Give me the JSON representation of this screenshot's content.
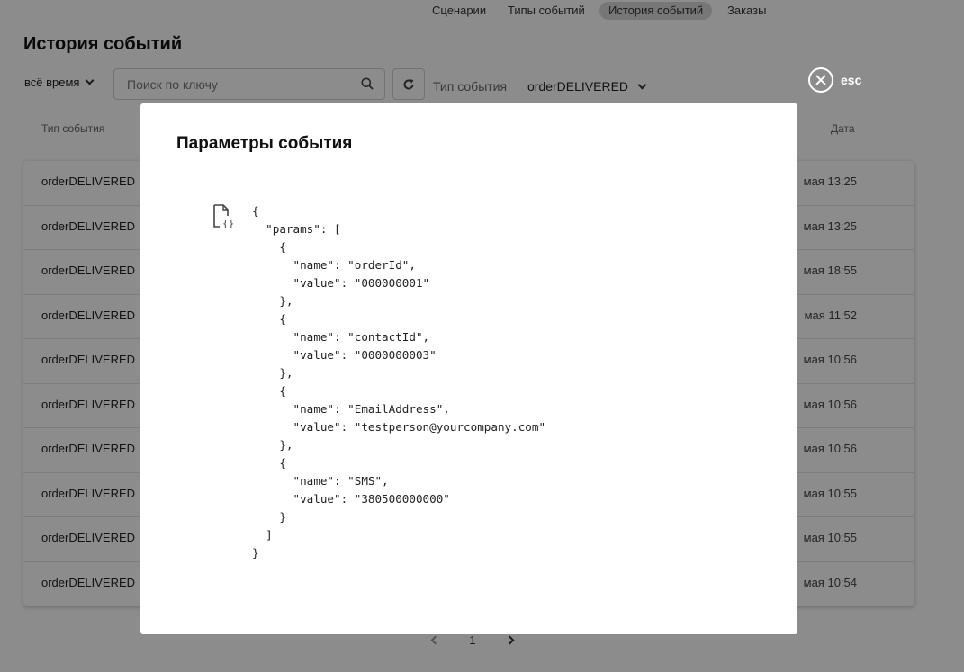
{
  "nav": {
    "items": [
      {
        "label": "Сценарии",
        "active": false
      },
      {
        "label": "Типы событий",
        "active": false
      },
      {
        "label": "История событий",
        "active": true
      },
      {
        "label": "Заказы",
        "active": false
      }
    ]
  },
  "page": {
    "title": "История событий"
  },
  "toolbar": {
    "period": "всё время",
    "search_placeholder": "Поиск по ключу",
    "type_label": "Тип события",
    "type_value": "orderDELIVERED"
  },
  "table": {
    "headers": {
      "type": "Тип события",
      "date": "Дата"
    },
    "rows": [
      {
        "type": "orderDELIVERED",
        "date": "мая 13:25"
      },
      {
        "type": "orderDELIVERED",
        "date": "мая 13:25"
      },
      {
        "type": "orderDELIVERED",
        "date": "мая 18:55"
      },
      {
        "type": "orderDELIVERED",
        "date": "мая 11:52"
      },
      {
        "type": "orderDELIVERED",
        "date": "мая 10:56"
      },
      {
        "type": "orderDELIVERED",
        "date": "мая 10:56"
      },
      {
        "type": "orderDELIVERED",
        "date": "мая 10:56"
      },
      {
        "type": "orderDELIVERED",
        "date": "мая 10:55"
      },
      {
        "type": "orderDELIVERED",
        "date": "мая 10:55"
      },
      {
        "type": "orderDELIVERED",
        "date": "мая 10:54"
      }
    ]
  },
  "pagination": {
    "current": "1"
  },
  "modal": {
    "close_label": "esc",
    "title": "Параметры события",
    "icon": "json-file-icon",
    "json_text": "{\n  \"params\": [\n    {\n      \"name\": \"orderId\",\n      \"value\": \"000000001\"\n    },\n    {\n      \"name\": \"contactId\",\n      \"value\": \"0000000003\"\n    },\n    {\n      \"name\": \"EmailAddress\",\n      \"value\": \"testperson@yourcompany.com\"\n    },\n    {\n      \"name\": \"SMS\",\n      \"value\": \"380500000000\"\n    }\n  ]\n}"
  },
  "colors": {
    "overlay": "#000000",
    "active_tab": "#d9d9d9"
  }
}
